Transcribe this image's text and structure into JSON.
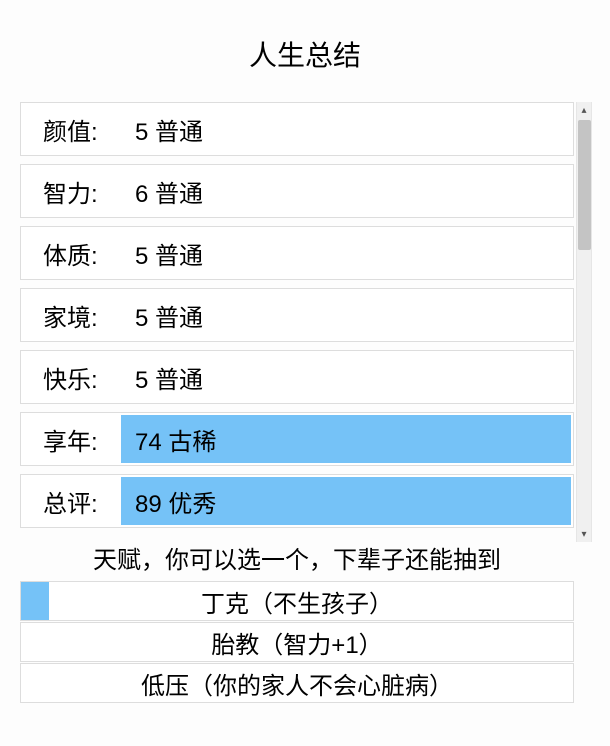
{
  "title": "人生总结",
  "stats": [
    {
      "label": "颜值:",
      "value": "5 普通",
      "highlight": false
    },
    {
      "label": "智力:",
      "value": "6 普通",
      "highlight": false
    },
    {
      "label": "体质:",
      "value": "5 普通",
      "highlight": false
    },
    {
      "label": "家境:",
      "value": "5 普通",
      "highlight": false
    },
    {
      "label": "快乐:",
      "value": "5 普通",
      "highlight": false
    },
    {
      "label": "享年:",
      "value": "74 古稀",
      "highlight": true
    },
    {
      "label": "总评:",
      "value": "89 优秀",
      "highlight": true
    }
  ],
  "talent_header": "天赋，你可以选一个，下辈子还能抽到",
  "talents": [
    {
      "text": "丁克（不生孩子）",
      "selected": true
    },
    {
      "text": "胎教（智力+1）",
      "selected": false
    },
    {
      "text": "低压（你的家人不会心脏病）",
      "selected": false
    }
  ],
  "scroll": {
    "up": "▴",
    "down": "▾"
  }
}
